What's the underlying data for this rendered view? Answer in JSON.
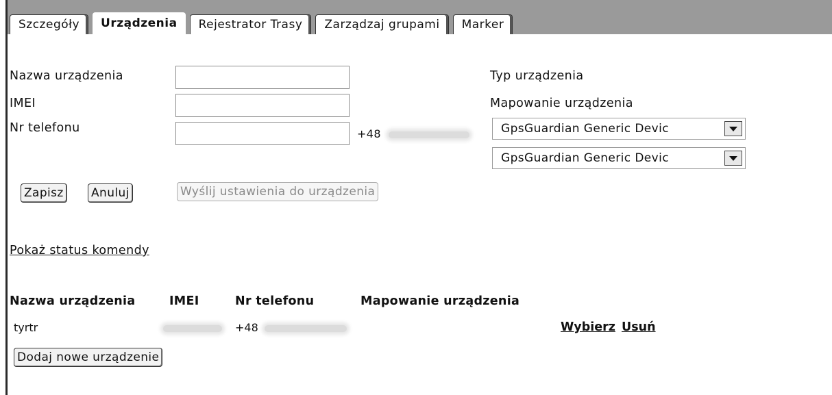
{
  "tabs": [
    {
      "label": "Szczegóły",
      "active": false
    },
    {
      "label": "Urządzenia",
      "active": true
    },
    {
      "label": "Rejestrator Trasy",
      "active": false
    },
    {
      "label": "Zarządzaj grupami",
      "active": false
    },
    {
      "label": "Marker",
      "active": false
    }
  ],
  "form": {
    "name_label": "Nazwa urządzenia",
    "name_value": "",
    "imei_label": "IMEI",
    "imei_value": "",
    "phone_label": "Nr telefonu",
    "phone_value": "",
    "phone_prefix": "+48",
    "type_label": "Typ urządzenia",
    "mapping_label": "Mapowanie urządzenia",
    "type_select": "GpsGuardian Generic Devic",
    "mapping_select": "GpsGuardian Generic Devic",
    "save_button": "Zapisz",
    "cancel_button": "Anuluj",
    "send_button": "Wyślij ustawienia do urządzenia"
  },
  "command_status_link": "Pokaż status komendy",
  "table": {
    "headers": [
      "Nazwa urządzenia",
      "IMEI",
      "Nr telefonu",
      "Mapowanie urządzenia"
    ],
    "rows": [
      {
        "name": "tyrtr",
        "phone_prefix": "+48",
        "select": "Wybierz",
        "delete": "Usuń"
      }
    ]
  },
  "add_button": "Dodaj nowe urządzenie"
}
